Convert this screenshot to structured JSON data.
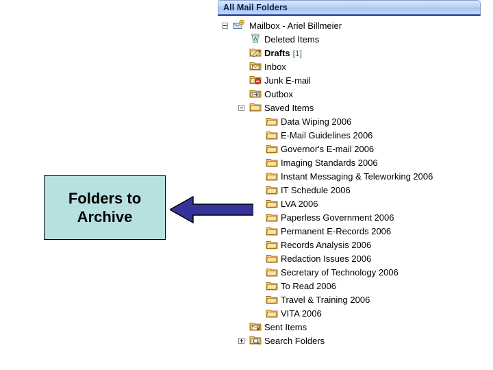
{
  "pane": {
    "header_title": "All Mail Folders"
  },
  "tree": [
    {
      "label": "Mailbox - Ariel Billmeier",
      "icon": "mailbox-icon",
      "level": 0,
      "expander": "minus",
      "bold": false,
      "count": ""
    },
    {
      "label": "Deleted Items",
      "icon": "deleted-items-icon",
      "level": 1,
      "expander": "none",
      "bold": false,
      "count": ""
    },
    {
      "label": "Drafts",
      "icon": "drafts-icon",
      "level": 1,
      "expander": "none",
      "bold": true,
      "count": "[1]"
    },
    {
      "label": "Inbox",
      "icon": "inbox-icon",
      "level": 1,
      "expander": "none",
      "bold": false,
      "count": ""
    },
    {
      "label": "Junk E-mail",
      "icon": "junk-email-icon",
      "level": 1,
      "expander": "none",
      "bold": false,
      "count": ""
    },
    {
      "label": "Outbox",
      "icon": "outbox-icon",
      "level": 1,
      "expander": "none",
      "bold": false,
      "count": ""
    },
    {
      "label": "Saved Items",
      "icon": "folder-icon",
      "level": 1,
      "expander": "minus",
      "bold": false,
      "count": ""
    },
    {
      "label": "Data Wiping 2006",
      "icon": "folder-icon",
      "level": 2,
      "expander": "none",
      "bold": false,
      "count": ""
    },
    {
      "label": "E-Mail Guidelines 2006",
      "icon": "folder-icon",
      "level": 2,
      "expander": "none",
      "bold": false,
      "count": ""
    },
    {
      "label": "Governor's E-mail 2006",
      "icon": "folder-icon",
      "level": 2,
      "expander": "none",
      "bold": false,
      "count": ""
    },
    {
      "label": "Imaging Standards 2006",
      "icon": "folder-icon",
      "level": 2,
      "expander": "none",
      "bold": false,
      "count": ""
    },
    {
      "label": "Instant Messaging & Teleworking 2006",
      "icon": "folder-icon",
      "level": 2,
      "expander": "none",
      "bold": false,
      "count": ""
    },
    {
      "label": "IT Schedule 2006",
      "icon": "folder-icon",
      "level": 2,
      "expander": "none",
      "bold": false,
      "count": ""
    },
    {
      "label": "LVA 2006",
      "icon": "folder-icon",
      "level": 2,
      "expander": "none",
      "bold": false,
      "count": ""
    },
    {
      "label": "Paperless Government 2006",
      "icon": "folder-icon",
      "level": 2,
      "expander": "none",
      "bold": false,
      "count": ""
    },
    {
      "label": "Permanent E-Records 2006",
      "icon": "folder-icon",
      "level": 2,
      "expander": "none",
      "bold": false,
      "count": ""
    },
    {
      "label": "Records Analysis 2006",
      "icon": "folder-icon",
      "level": 2,
      "expander": "none",
      "bold": false,
      "count": ""
    },
    {
      "label": "Redaction Issues 2006",
      "icon": "folder-icon",
      "level": 2,
      "expander": "none",
      "bold": false,
      "count": ""
    },
    {
      "label": "Secretary of Technology 2006",
      "icon": "folder-icon",
      "level": 2,
      "expander": "none",
      "bold": false,
      "count": ""
    },
    {
      "label": "To Read 2006",
      "icon": "folder-icon",
      "level": 2,
      "expander": "none",
      "bold": false,
      "count": ""
    },
    {
      "label": "Travel & Training 2006",
      "icon": "folder-icon",
      "level": 2,
      "expander": "none",
      "bold": false,
      "count": ""
    },
    {
      "label": "VITA 2006",
      "icon": "folder-icon",
      "level": 2,
      "expander": "none",
      "bold": false,
      "count": ""
    },
    {
      "label": "Sent Items",
      "icon": "sent-items-icon",
      "level": 1,
      "expander": "none",
      "bold": false,
      "count": ""
    },
    {
      "label": "Search Folders",
      "icon": "search-folders-icon",
      "level": 1,
      "expander": "plus",
      "bold": false,
      "count": ""
    }
  ],
  "callout": {
    "line1": "Folders to",
    "line2": "Archive",
    "box_fill": "#b7e0e1",
    "box_border": "#000000",
    "arrow_fill": "#333399",
    "arrow_border": "#000000",
    "arrow_direction": "left"
  }
}
